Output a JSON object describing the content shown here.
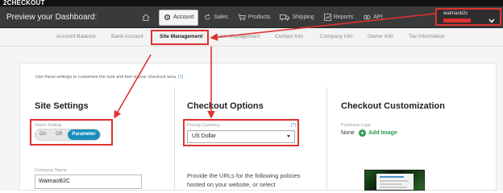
{
  "brand": {
    "name": "2CHECKOUT"
  },
  "topbar": {
    "preview_label": "Preview your Dashboard:",
    "nav": [
      {
        "label": "",
        "icon": "home-icon"
      },
      {
        "label": "Account",
        "icon": "gear-icon",
        "active": true
      },
      {
        "label": "Sales",
        "icon": "refresh-icon"
      },
      {
        "label": "Products",
        "icon": "cart-icon"
      },
      {
        "label": "Shipping",
        "icon": "truck-icon"
      },
      {
        "label": "Reports",
        "icon": "chart-icon"
      },
      {
        "label": "API",
        "icon": "api-icon"
      }
    ],
    "account": {
      "name": "waimaob2c",
      "chevron_icon": "chevron-down-icon"
    }
  },
  "subnav": {
    "tabs": [
      {
        "label": "Account Balance"
      },
      {
        "label": "Bank Account"
      },
      {
        "label": "Site Management",
        "active": true
      },
      {
        "label": "User Management"
      },
      {
        "label": "Contact Info"
      },
      {
        "label": "Company Info"
      },
      {
        "label": "Owner Info"
      },
      {
        "label": "Tax Information"
      }
    ]
  },
  "intro": {
    "text": "Use these settings to customize the look and feel of your checkout area.",
    "help": "[?]"
  },
  "site_settings": {
    "title": "Site Settings",
    "demo_label": "Demo Setting",
    "toggle": {
      "on": "On",
      "off": "Off",
      "parameter": "Parameter",
      "selected": "Parameter"
    },
    "company_label": "Company Name",
    "company_value": "WaimaoB2C"
  },
  "checkout_options": {
    "title": "Checkout Options",
    "currency_label": "Pricing Currency",
    "currency_help": "[?]",
    "currency_value": "US Dollar",
    "urls_text": "Provide the URLs for the following policies hosted on your website, or select"
  },
  "checkout_customization": {
    "title": "Checkout Customization",
    "logo_label": "Purchase Logo",
    "none_label": "None",
    "add_image_label": "Add Image"
  },
  "colors": {
    "highlight": "#e03131",
    "toggle_active": "#1a8fbf",
    "add_image": "#2e9b4e",
    "topbar": "#3a3a3a"
  }
}
